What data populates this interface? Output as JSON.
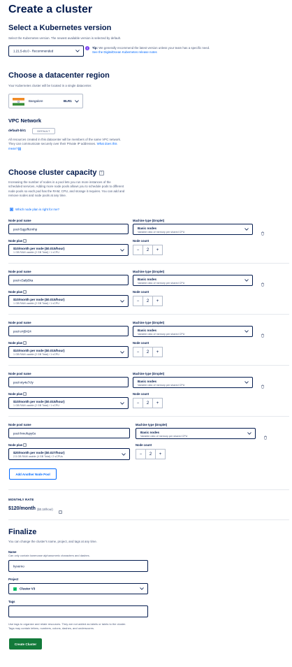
{
  "page": {
    "title": "Create a cluster"
  },
  "k8s": {
    "heading": "Select a Kubernetes version",
    "desc": "Select the Kubernetes version. The newest available version is selected by default.",
    "version": "1.21.5-do.0 - Recommended",
    "tip_label": "Tip:",
    "tip_text": " We generally recommend the latest version unless your team has a specific need.",
    "tip_link": "See the DigitalOcean Kubernetes release notes"
  },
  "region": {
    "heading": "Choose a datacenter region",
    "desc": "Your Kubernetes cluster will be located in a single datacenter.",
    "name": "Bangalore",
    "code": "BLR1"
  },
  "vpc": {
    "heading": "VPC Network",
    "name": "default-blr1",
    "badge": "DEFAULT",
    "desc_line1": "All resources created in this datacenter will be members of the same VPC network.",
    "desc_line2": "They can communicate securely over their Private IP addresses. ",
    "desc_link1": "What does this",
    "desc_link2": "mean?"
  },
  "capacity": {
    "heading": "Choose cluster capacity",
    "desc_lines": [
      "Increasing the number of nodes in a pool lets you run more instances of the",
      "scheduled services. Adding more node pools allows you to schedule pods to different",
      "node pools so each pod has the RAM, CPU, and storage it requires. You can add and",
      "remove nodes and node pools at any time."
    ],
    "help_link": "Which node plan is right for me?",
    "labels": {
      "pool_name": "Node pool name",
      "machine_type": "Machine type (Droplet)",
      "node_plan": "Node plan",
      "node_count": "Node count"
    },
    "pools": [
      {
        "name": "pool-5qgzfkzmhp",
        "machine": "Basic nodes",
        "machine_sub": "Variable ratio of memory per shared CPU",
        "plan": "$10/month per node ($0.015/hour)",
        "plan_sub": "1 GB RAM usable (2 GB Total) / 1 vCPU",
        "count": "2",
        "minus": "−",
        "plus": "+"
      },
      {
        "name": "pool-c5afp5ka",
        "machine": "Basic nodes",
        "machine_sub": "Variable ratio of memory per shared CPU",
        "plan": "$10/month per node ($0.015/hour)",
        "plan_sub": "1 GB RAM usable (2 GB Total) / 1 vCPU",
        "count": "2",
        "minus": "−",
        "plus": "+"
      },
      {
        "name": "pool-z4j5424",
        "machine": "Basic nodes",
        "machine_sub": "Variable ratio of memory per shared CPU",
        "plan": "$10/month per node ($0.015/hour)",
        "plan_sub": "1 GB RAM usable (2 GB Total) / 1 vCPU",
        "count": "2",
        "minus": "−",
        "plus": "+"
      },
      {
        "name": "pool-xty4e7cly",
        "machine": "Basic nodes",
        "machine_sub": "Variable ratio of memory per shared CPU",
        "plan": "$10/month per node ($0.015/hour)",
        "plan_sub": "1 GB RAM usable (2 GB Total) / 1 vCPU",
        "count": "2",
        "minus": "−",
        "plus": "+"
      },
      {
        "name": "pool-hmofupy6o",
        "machine": "Basic nodes",
        "machine_sub": "Variable ratio of memory per shared CPU",
        "plan": "$20/month per node ($0.027/hour)",
        "plan_sub": "2.5 GB RAM usable (4 GB Total) / 2 vCPUs",
        "count": "2",
        "minus": "−",
        "plus": "+"
      }
    ],
    "add_pool": "Add Another Node Pool"
  },
  "rate": {
    "label": "MONTHLY RATE",
    "amount": "$120/month",
    "hourly": "($0.18/hour)"
  },
  "finalize": {
    "heading": "Finalize",
    "desc": "You can change the cluster's name, project, and tags at any time.",
    "name_label": "Name",
    "name_hint": "Can only contain lowercase alphanumeric characters and dashes.",
    "name_value": "kyverno",
    "project_label": "Project",
    "project_value": "Cluster V3",
    "tags_label": "Tags",
    "tags_value": "",
    "tags_hint1": "Use tags to organize and relate resources. They are not added as labels or taints to the cluster.",
    "tags_hint2": "Tags may contain letters, numbers, colons, dashes, and underscores.",
    "create": "Create Cluster"
  }
}
